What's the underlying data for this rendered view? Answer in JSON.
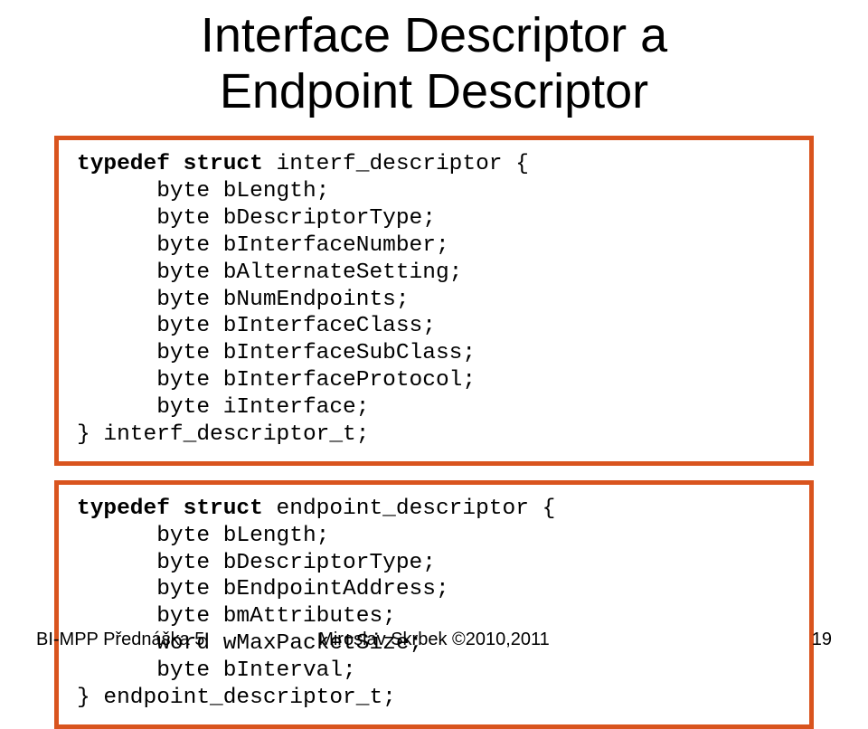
{
  "title_line1": "Interface Descriptor a",
  "title_line2": "Endpoint Descriptor",
  "code1": {
    "l0_kw": "typedef struct ",
    "l0_rest": "interf_descriptor {",
    "l1": "      byte bLength;",
    "l2": "      byte bDescriptorType;",
    "l3": "      byte bInterfaceNumber;",
    "l4": "      byte bAlternateSetting;",
    "l5": "      byte bNumEndpoints;",
    "l6": "      byte bInterfaceClass;",
    "l7": "      byte bInterfaceSubClass;",
    "l8": "      byte bInterfaceProtocol;",
    "l9": "      byte iInterface;",
    "l10": "} interf_descriptor_t;"
  },
  "code2": {
    "l0_kw": "typedef struct ",
    "l0_rest": "endpoint_descriptor {",
    "l1": "      byte bLength;",
    "l2": "      byte bDescriptorType;",
    "l3": "      byte bEndpointAddress;",
    "l4": "      byte bmAttributes;",
    "l5": "      word wMaxPacketSize;",
    "l6": "      byte bInterval;",
    "l7": "} endpoint_descriptor_t;"
  },
  "footer": {
    "left": "BI-MPP Přednáška 5",
    "center": "Miroslav Skrbek ©2010,2011",
    "right": "19"
  }
}
